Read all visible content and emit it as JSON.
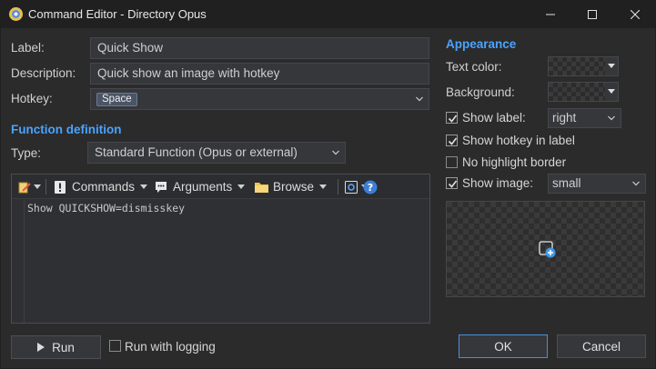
{
  "window": {
    "title": "Command Editor - Directory Opus"
  },
  "form": {
    "label_caption": "Label:",
    "label_value": "Quick Show",
    "description_caption": "Description:",
    "description_value": "Quick show an image with hotkey",
    "hotkey_caption": "Hotkey:",
    "hotkey_value": "Space"
  },
  "function": {
    "section_title": "Function definition",
    "type_caption": "Type:",
    "type_value": "Standard Function (Opus or external)",
    "toolbar": {
      "commands": "Commands",
      "arguments": "Arguments",
      "browse": "Browse"
    },
    "code": "Show QUICKSHOW=dismisskey"
  },
  "appearance": {
    "section_title": "Appearance",
    "text_color_caption": "Text color:",
    "background_caption": "Background:",
    "show_label": {
      "label": "Show label:",
      "checked": true,
      "value": "right"
    },
    "show_hotkey": {
      "label": "Show hotkey in label",
      "checked": true
    },
    "no_highlight": {
      "label": "No highlight border",
      "checked": false
    },
    "show_image": {
      "label": "Show image:",
      "checked": true,
      "value": "small"
    }
  },
  "footer": {
    "run_label": "Run",
    "run_logging_label": "Run with logging",
    "run_logging_checked": false,
    "ok_label": "OK",
    "cancel_label": "Cancel"
  },
  "colors": {
    "accent": "#4aa3ff",
    "background": "#2b2b2b",
    "field": "#35373b",
    "ok_border": "#4a90d9"
  },
  "icons": [
    "app-icon",
    "minimize-icon",
    "maximize-icon",
    "close-icon",
    "edit-tool-icon",
    "commands-icon",
    "arguments-icon",
    "folder-icon",
    "dialog-icon",
    "help-icon",
    "play-icon",
    "add-image-icon"
  ]
}
